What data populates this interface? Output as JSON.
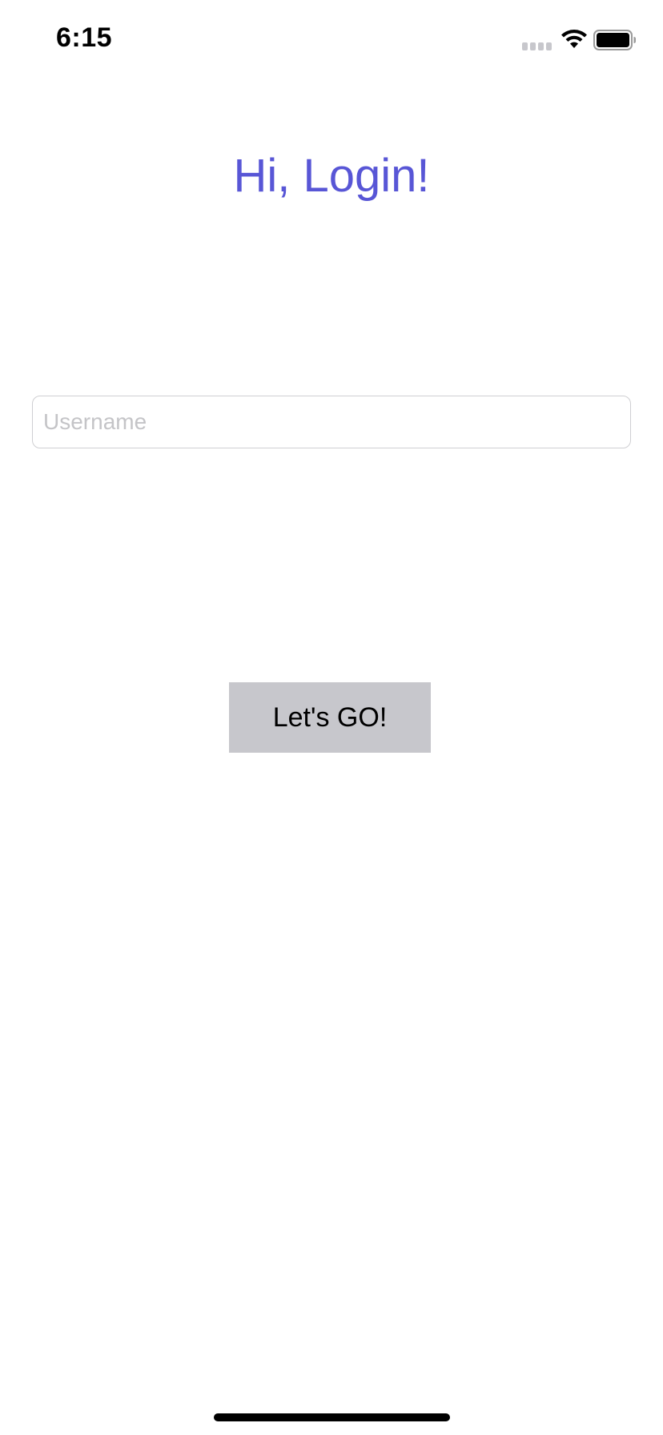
{
  "status_bar": {
    "time": "6:15",
    "signal_icon": "cellular-signal-icon",
    "wifi_icon": "wifi-icon",
    "battery_icon": "battery-icon"
  },
  "screen": {
    "title": "Hi, Login!",
    "username": {
      "value": "",
      "placeholder": "Username"
    },
    "submit_label": "Let's GO!"
  },
  "colors": {
    "title": "#5856d6",
    "button_background": "#c7c7cc",
    "placeholder": "#c4c4c7"
  }
}
